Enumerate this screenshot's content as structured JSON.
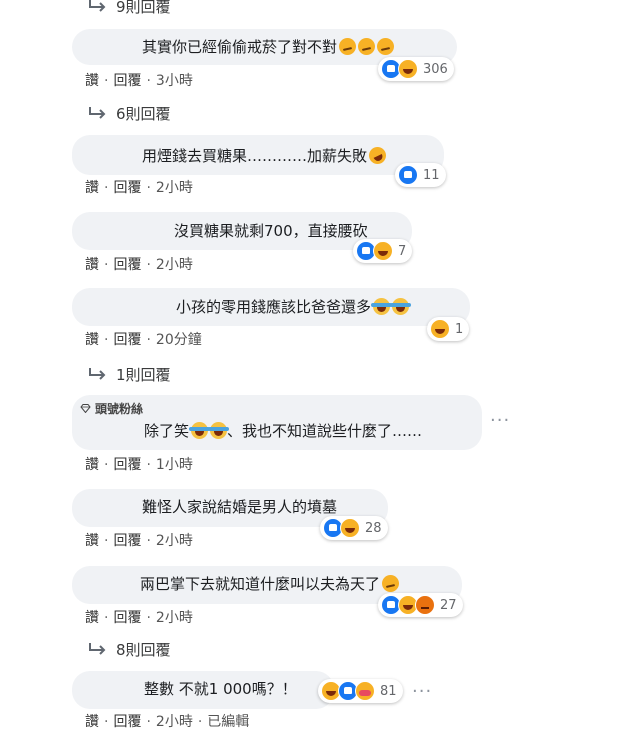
{
  "reply_links": [
    {
      "label": "9則回覆"
    },
    {
      "label": "6則回覆"
    },
    {
      "label": "1則回覆"
    },
    {
      "label": "8則回覆"
    }
  ],
  "action_labels": {
    "like": "讚",
    "reply": "回覆"
  },
  "badge": {
    "label": "頭號粉絲",
    "icon": "diamond-icon"
  },
  "more_options_label": "···",
  "comments": [
    {
      "text": "其實你已經偷偷戒菸了對不對",
      "emoji": [
        "smirk",
        "smirk",
        "smirk"
      ],
      "time": "3小時",
      "count": "306",
      "reactions": [
        "like",
        "haha"
      ]
    },
    {
      "text": "用煙錢去買糖果…………加薪失敗",
      "emoji": [
        "rofl"
      ],
      "time": "2小時",
      "count": "11",
      "reactions": [
        "like"
      ]
    },
    {
      "text": "沒買糖果就剩700，直接腰砍",
      "emoji": [],
      "time": "2小時",
      "count": "7",
      "reactions": [
        "like",
        "haha"
      ]
    },
    {
      "text": "小孩的零用錢應該比爸爸還多",
      "emoji": [
        "cry",
        "cry"
      ],
      "time": "20分鐘",
      "count": "1",
      "reactions": [
        "haha"
      ]
    },
    {
      "text": "除了笑",
      "text2": "、我也不知道說些什麼了……",
      "emoji": [
        "cry",
        "cry"
      ],
      "time": "1小時",
      "count": "",
      "reactions": []
    },
    {
      "text": "難怪人家說結婚是男人的墳墓",
      "emoji": [],
      "time": "2小時",
      "count": "28",
      "reactions": [
        "like",
        "haha"
      ]
    },
    {
      "text": "兩巴掌下去就知道什麼叫以夫為天了",
      "emoji": [
        "smirk"
      ],
      "time": "2小時",
      "count": "27",
      "reactions": [
        "like",
        "haha",
        "angry"
      ]
    },
    {
      "text": "整數 不就1 000嗎？！",
      "emoji": [],
      "time": "2小時",
      "edited": "已編輯",
      "count": "81",
      "reactions": [
        "haha",
        "like",
        "care"
      ]
    }
  ]
}
